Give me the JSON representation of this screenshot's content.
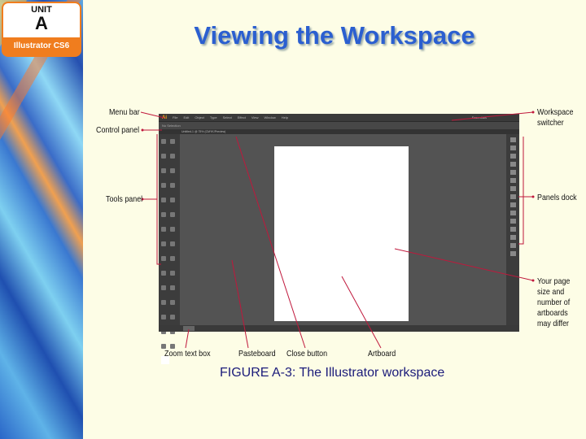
{
  "badge": {
    "unit": "UNIT",
    "letter": "A",
    "product": "Illustrator CS6"
  },
  "title": "Viewing the Workspace",
  "app": {
    "logo": "Ai",
    "menu": [
      "File",
      "Edit",
      "Object",
      "Type",
      "Select",
      "Effect",
      "View",
      "Window",
      "Help"
    ],
    "control_text": "No Selection",
    "document_tab": "Untitled-1 @ 75% (CMYK/Preview)",
    "workspace": "Essentials"
  },
  "callouts": {
    "menu_bar": "Menu bar",
    "control_panel": "Control panel",
    "tools_panel": "Tools panel",
    "workspace_switcher": "Workspace switcher",
    "panels_dock": "Panels dock",
    "page_size_note": "Your page size and number of artboards may differ",
    "zoom_text_box": "Zoom text box",
    "pasteboard": "Pasteboard",
    "close_button": "Close button",
    "artboard": "Artboard"
  },
  "caption": "FIGURE A-3: The Illustrator workspace",
  "colors": {
    "title": "#2b5fd0",
    "leader": "#c0183c",
    "badge": "#f07d1e"
  }
}
